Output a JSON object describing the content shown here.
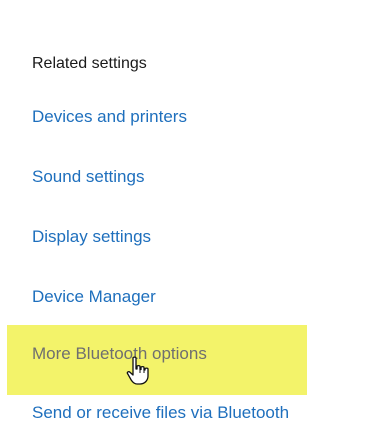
{
  "related_settings": {
    "heading": "Related settings",
    "links": {
      "devices_and_printers": "Devices and printers",
      "sound_settings": "Sound settings",
      "display_settings": "Display settings",
      "device_manager": "Device Manager",
      "more_bluetooth_options": "More Bluetooth options",
      "send_receive_bluetooth": "Send or receive files via Bluetooth"
    }
  },
  "colors": {
    "link": "#1e6fbd",
    "heading": "#1a1a1a",
    "highlight": "#f3f36a",
    "hovered_link": "#6f6f6f"
  },
  "icons": {
    "cursor": "hand-pointer-icon"
  }
}
